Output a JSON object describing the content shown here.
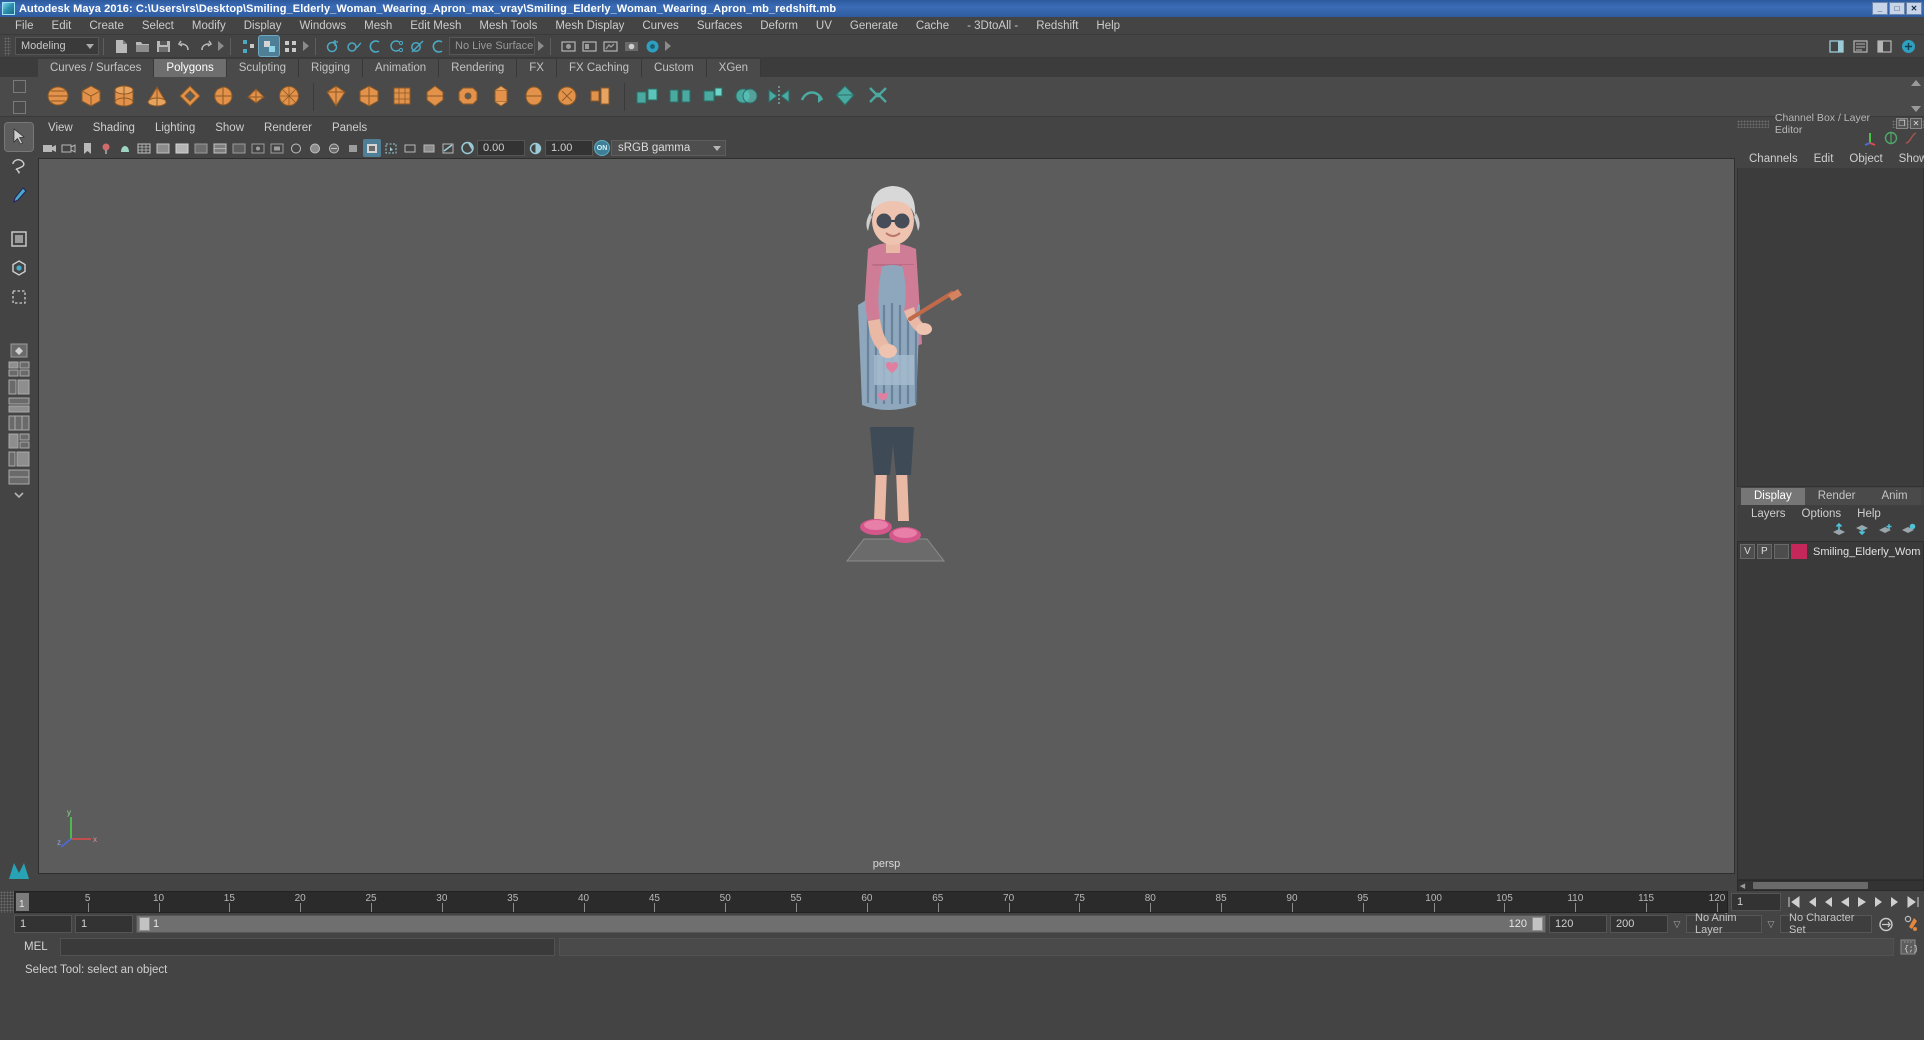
{
  "window": {
    "title": "Autodesk Maya 2016: C:\\Users\\rs\\Desktop\\Smiling_Elderly_Woman_Wearing_Apron_max_vray\\Smiling_Elderly_Woman_Wearing_Apron_mb_redshift.mb",
    "minimize_label": "_",
    "maximize_label": "□",
    "close_label": "✕"
  },
  "menubar": {
    "items": [
      {
        "label": "File"
      },
      {
        "label": "Edit"
      },
      {
        "label": "Create"
      },
      {
        "label": "Select"
      },
      {
        "label": "Modify"
      },
      {
        "label": "Display"
      },
      {
        "label": "Windows"
      },
      {
        "label": "Mesh"
      },
      {
        "label": "Edit Mesh"
      },
      {
        "label": "Mesh Tools"
      },
      {
        "label": "Mesh Display"
      },
      {
        "label": "Curves"
      },
      {
        "label": "Surfaces"
      },
      {
        "label": "Deform"
      },
      {
        "label": "UV"
      },
      {
        "label": "Generate"
      },
      {
        "label": "Cache"
      },
      {
        "label": "- 3DtoAll -"
      },
      {
        "label": "Redshift"
      },
      {
        "label": "Help"
      }
    ]
  },
  "statusbar": {
    "menuset": "Modeling",
    "live_surface": "No Live Surface",
    "icons": [
      "new-scene-icon",
      "open-scene-icon",
      "save-scene-icon",
      "undo-icon",
      "redo-icon",
      "select-by-hierarchy-icon",
      "select-by-object-icon",
      "select-by-component-icon",
      "snap-to-grid-icon",
      "snap-to-curve-icon",
      "snap-to-point-icon",
      "snap-to-projected-center-icon",
      "snap-to-view-plane-icon",
      "make-live-icon",
      "render-current-frame-icon",
      "ipr-render-icon",
      "render-settings-icon",
      "hypershade-icon",
      "render-view-icon"
    ],
    "right_icons": [
      "sidebar-toggle-icon",
      "attribute-editor-icon",
      "tool-settings-icon",
      "channel-box-icon"
    ]
  },
  "shelf": {
    "tabs": [
      {
        "label": "Curves / Surfaces",
        "active": false
      },
      {
        "label": "Polygons",
        "active": true
      },
      {
        "label": "Sculpting",
        "active": false
      },
      {
        "label": "Rigging",
        "active": false
      },
      {
        "label": "Animation",
        "active": false
      },
      {
        "label": "Rendering",
        "active": false
      },
      {
        "label": "FX",
        "active": false
      },
      {
        "label": "FX Caching",
        "active": false
      },
      {
        "label": "Custom",
        "active": false
      },
      {
        "label": "XGen",
        "active": false
      }
    ],
    "icons_orange": [
      "poly-sphere-icon",
      "poly-cube-icon",
      "poly-cylinder-icon",
      "poly-cone-icon",
      "poly-torus-icon",
      "poly-plane-icon",
      "poly-disc-icon",
      "poly-platonic-icon",
      "poly-pyramid-icon",
      "poly-prism-icon",
      "poly-pipe-icon",
      "poly-helix-icon",
      "poly-gear-icon",
      "poly-soccer-ball-icon",
      "poly-super-ellipse-icon",
      "poly-spherical-harmonics-icon",
      "poly-ultra-shape-icon",
      "poly-type-icon",
      "poly-svg-icon",
      "poly-sweep-icon"
    ],
    "icons_teal": [
      "combine-icon",
      "separate-icon",
      "extract-icon",
      "booleans-icon",
      "mirror-icon",
      "smooth-icon",
      "reduce-icon",
      "retopologize-icon"
    ]
  },
  "toolbox": {
    "tools": [
      {
        "name": "select-tool",
        "active": true
      },
      {
        "name": "lasso-select-tool",
        "active": false
      },
      {
        "name": "paint-select-tool",
        "active": false
      },
      {
        "name": "move-tool",
        "active": false
      },
      {
        "name": "rotate-tool",
        "active": false
      },
      {
        "name": "scale-tool",
        "active": false
      },
      {
        "name": "last-tool-used",
        "active": false
      }
    ],
    "layouts": [
      "single-perspective-view-icon",
      "four-view-icon",
      "outliner-persp-icon",
      "persp-graph-icon",
      "hypershade-persp-icon",
      "persp-hypergraph-icon",
      "outliner-persp-graph-icon",
      "persp-graph-hypershade-icon",
      "more-layouts-icon"
    ]
  },
  "viewport": {
    "panel_menus": [
      {
        "label": "View"
      },
      {
        "label": "Shading"
      },
      {
        "label": "Lighting"
      },
      {
        "label": "Show"
      },
      {
        "label": "Renderer"
      },
      {
        "label": "Panels"
      }
    ],
    "exposure": "0.00",
    "gamma": "1.00",
    "color_management_toggle": "ON",
    "color_profile": "sRGB gamma",
    "camera_label": "persp",
    "axis_labels": {
      "x": "x",
      "y": "y",
      "z": "z"
    },
    "background_color": "#5c5c5c"
  },
  "channel_box": {
    "panel_title": "Channel Box / Layer Editor",
    "menus": [
      {
        "label": "Channels"
      },
      {
        "label": "Edit"
      },
      {
        "label": "Object"
      },
      {
        "label": "Show"
      }
    ],
    "header_icons": [
      "channel-box-axis-icon",
      "attribute-sphere-icon",
      "anim-curve-icon"
    ],
    "undock_label": "❐",
    "close_label": "✕"
  },
  "layer_editor": {
    "tabs": [
      {
        "label": "Display",
        "active": true
      },
      {
        "label": "Render",
        "active": false
      },
      {
        "label": "Anim",
        "active": false
      }
    ],
    "menus": [
      {
        "label": "Layers"
      },
      {
        "label": "Options"
      },
      {
        "label": "Help"
      }
    ],
    "tool_icons": [
      "move-layer-up-icon",
      "move-layer-down-icon",
      "new-layer-icon",
      "new-layer-from-selected-icon"
    ],
    "rows": [
      {
        "visibility": "V",
        "playback": "P",
        "state": "",
        "color": "#c4285a",
        "name": "Smiling_Elderly_Woman_"
      }
    ]
  },
  "timeline": {
    "start": 1,
    "end": 120,
    "current_frame": "1",
    "tick_labels": [
      "5",
      "10",
      "15",
      "20",
      "25",
      "30",
      "35",
      "40",
      "45",
      "50",
      "55",
      "60",
      "65",
      "70",
      "75",
      "80",
      "85",
      "90",
      "95",
      "100",
      "105",
      "110",
      "115",
      "120"
    ],
    "current_frame_marker_label": "1",
    "playback_buttons": [
      "go-to-start-icon",
      "step-back-key-icon",
      "step-back-frame-icon",
      "play-backwards-icon",
      "play-forwards-icon",
      "step-forward-frame-icon",
      "step-forward-key-icon",
      "go-to-end-icon"
    ]
  },
  "range_slider": {
    "anim_start": "1",
    "range_start": "1",
    "bar_left_label": "1",
    "bar_right_label": "120",
    "range_end": "120",
    "anim_end": "200",
    "anim_layer": "No Anim Layer",
    "character_set": "No Character Set",
    "auto_key_icon": "auto-keyframe-icon",
    "anim_prefs_icon": "animation-preferences-icon"
  },
  "command_line": {
    "language_label": "MEL",
    "input_value": "",
    "output_value": "",
    "script_editor_icon": "script-editor-icon"
  },
  "help_line": {
    "text": "Select Tool: select an object"
  },
  "colors": {
    "accent_blue": "#3d7f96",
    "shelf_orange": "#e2924a",
    "shelf_teal": "#4aa9a0",
    "title_blue": "#2d5a9e",
    "panel_bg": "#444444",
    "viewport_bg": "#5c5c5c"
  }
}
